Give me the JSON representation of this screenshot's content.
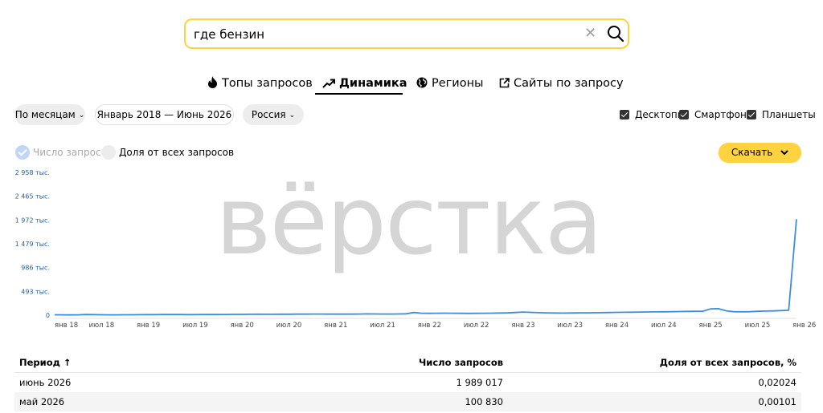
{
  "search": {
    "value": "где бензин",
    "clear_symbol": "✕"
  },
  "tabs": [
    {
      "label": "Топы запросов",
      "icon": "fire-icon"
    },
    {
      "label": "Динамика",
      "icon": "trend-icon",
      "active": true
    },
    {
      "label": "Регионы",
      "icon": "globe-icon"
    },
    {
      "label": "Сайты по запросу",
      "icon": "external-link-icon"
    }
  ],
  "filters": {
    "group": "По месяцам",
    "period": "Январь 2018 — Июнь 2026",
    "region": "Россия",
    "chevron": "⌄"
  },
  "devices": [
    {
      "label": "Десктопы",
      "checked": true
    },
    {
      "label": "Смартфоны",
      "checked": true
    },
    {
      "label": "Планшеты",
      "checked": true
    }
  ],
  "metrics": {
    "count_label": "Число запросов",
    "share_label": "Доля от всех запросов"
  },
  "download_label": "Скачать",
  "watermark": "вёрстка",
  "chart_data": {
    "type": "line",
    "y_ticks": [
      "2 958 тыс.",
      "2 465 тыс.",
      "1 972 тыс.",
      "1 479 тыс.",
      "986 тыс.",
      "493 тыс.",
      "0"
    ],
    "x_ticks": [
      "янв 18",
      "июл 18",
      "янв 19",
      "июл 19",
      "янв 20",
      "июл 20",
      "янв 21",
      "июл 21",
      "янв 22",
      "июл 22",
      "янв 23",
      "июл 23",
      "янв 24",
      "июл 24",
      "янв 25",
      "июл 25",
      "янв 26"
    ],
    "ylim": [
      0,
      2958000
    ],
    "grid": false,
    "color": "#3a8de0",
    "series": [
      {
        "values": [
          8000,
          6000,
          5000,
          7000,
          14000,
          12000,
          9000,
          7000,
          6000,
          8000,
          9000,
          10000,
          11000,
          12000,
          13000,
          14000,
          13000,
          12000,
          12000,
          13000,
          14000,
          13000,
          15000,
          16000,
          17000,
          18000,
          20000,
          18000,
          19000,
          20000,
          20000,
          21000,
          22000,
          24000,
          23000,
          22000,
          22000,
          21000,
          22000,
          24000,
          26000,
          25000,
          24000,
          23000,
          25000,
          28000,
          55000,
          40000,
          38000,
          40000,
          42000,
          40000,
          38000,
          37000,
          38000,
          40000,
          42000,
          45000,
          48000,
          55000,
          65000,
          58000,
          52000,
          48000,
          45000,
          44000,
          45000,
          47000,
          48000,
          50000,
          52000,
          55000,
          58000,
          60000,
          62000,
          64000,
          66000,
          68000,
          70000,
          72000,
          75000,
          78000,
          80000,
          82000,
          130000,
          135000,
          90000,
          72000,
          70000,
          72000,
          80000,
          85000,
          88000,
          95000,
          100830,
          1989017
        ]
      }
    ]
  },
  "table": {
    "headers": [
      "Период ↑",
      "Число запросов",
      "Доля от всех запросов, %"
    ],
    "rows": [
      [
        "июнь 2026",
        "1 989 017",
        "0,02024"
      ],
      [
        "май 2026",
        "100 830",
        "0,00101"
      ]
    ]
  }
}
